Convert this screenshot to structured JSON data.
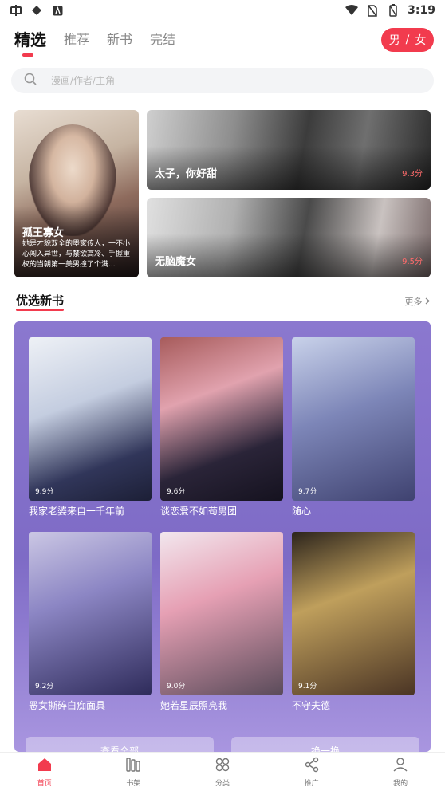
{
  "status_bar": {
    "left_icons": [
      "app-icon",
      "location-icon",
      "a-icon"
    ],
    "time": "3:19"
  },
  "top_tabs": [
    {
      "label": "精选",
      "active": true
    },
    {
      "label": "推荐",
      "active": false
    },
    {
      "label": "新书",
      "active": false
    },
    {
      "label": "完结",
      "active": false
    }
  ],
  "gender": {
    "male": "男",
    "sep": "/",
    "female": "女"
  },
  "search": {
    "placeholder": "漫画/作者/主角"
  },
  "featured": {
    "big": {
      "title": "孤王寡女",
      "desc": "她是才貌双全的墨家传人，一不小心闯入异世，与禁欲高冷、手握重权的当朝第一美男撞了个满..."
    },
    "wide": [
      {
        "title": "太子，你好甜",
        "score": "9.3分"
      },
      {
        "title": "无脑魔女",
        "score": "9.5分"
      }
    ]
  },
  "section": {
    "title": "优选新书",
    "more": "更多"
  },
  "books": [
    {
      "title": "我家老婆来自一千年前",
      "score": "9.9分"
    },
    {
      "title": "谈恋爱不如苟男团",
      "score": "9.6分"
    },
    {
      "title": "随心",
      "score": "9.7分"
    },
    {
      "title": "恶女撕碎白痴面具",
      "score": "9.2分"
    },
    {
      "title": "她若星辰照亮我",
      "score": "9.0分"
    },
    {
      "title": "不守夫德",
      "score": "9.1分"
    }
  ],
  "panel_buttons": {
    "view_all": "查看全部",
    "refresh": "换一换"
  },
  "bottom_nav": [
    {
      "label": "首页",
      "icon": "home-icon",
      "active": true
    },
    {
      "label": "书架",
      "icon": "bookshelf-icon",
      "active": false
    },
    {
      "label": "分类",
      "icon": "category-icon",
      "active": false
    },
    {
      "label": "推广",
      "icon": "share-icon",
      "active": false
    },
    {
      "label": "我的",
      "icon": "profile-icon",
      "active": false
    }
  ],
  "colors": {
    "accent": "#f23b4e",
    "panel": "#8b78cf"
  }
}
